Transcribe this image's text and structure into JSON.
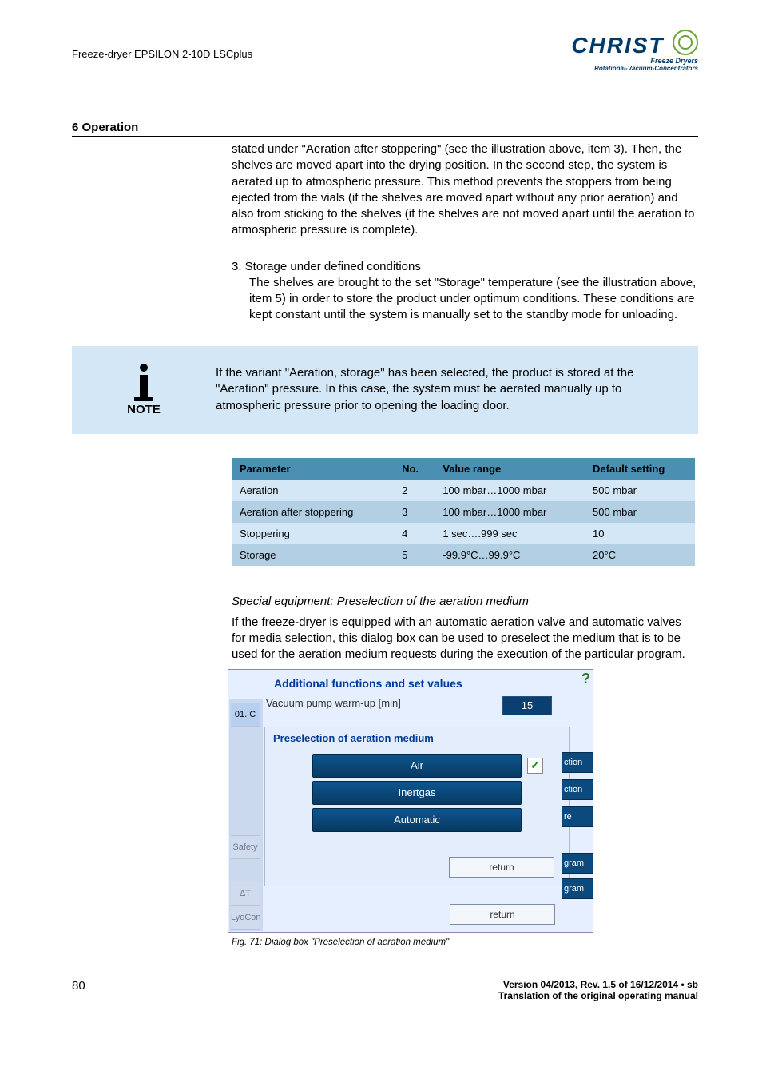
{
  "header": {
    "doc_title": "Freeze-dryer EPSILON 2-10D LSCplus",
    "logo_main": "CHRIST",
    "logo_sub1": "Freeze Dryers",
    "logo_sub2": "Rotational-Vacuum-Concentrators"
  },
  "section_title": "6 Operation",
  "para1": "stated under \"Aeration after stoppering\" (see the illustration above, item 3). Then, the shelves are moved apart into the drying position. In the second step, the system is aerated up to atmospheric pressure. This method prevents the stoppers from being ejected from the vials (if the shelves are moved apart without any prior aeration) and also from sticking to the shelves (if the shelves are not moved apart until the aeration to atmospheric pressure is complete).",
  "item3_title": "3.  Storage under defined conditions",
  "item3_body": "The shelves are brought to the set \"Storage\" temperature (see the illustration above, item 5) in order to store the product under optimum conditions. These conditions are kept constant until the system is manually set to the standby mode for unloading.",
  "note_label": "NOTE",
  "note_text": "If the variant \"Aeration, storage\" has been selected, the product is stored at the \"Aeration\" pressure. In this case, the system must be aerated manually up to atmospheric pressure prior to opening the loading door.",
  "table": {
    "headers": {
      "c1": "Parameter",
      "c2": "No.",
      "c3": "Value range",
      "c4": "Default setting"
    },
    "rows": [
      {
        "c1": "Aeration",
        "c2": "2",
        "c3": "100 mbar…1000 mbar",
        "c4": "500 mbar"
      },
      {
        "c1": "Aeration after stoppering",
        "c2": "3",
        "c3": "100 mbar…1000 mbar",
        "c4": "500 mbar"
      },
      {
        "c1": "Stoppering",
        "c2": "4",
        "c3": "1 sec….999 sec",
        "c4": "10"
      },
      {
        "c1": "Storage",
        "c2": "5",
        "c3": "-99.9°C…99.9°C",
        "c4": "20°C"
      }
    ]
  },
  "subheading": "Special equipment: Preselection of the aeration medium",
  "subbody": "If the freeze-dryer is equipped with an automatic aeration valve and automatic valves for media selection, this dialog box can be used to preselect the medium that is to be used for the aeration medium requests during the execution of the particular program.",
  "dialog": {
    "title": "Additional functions and set values",
    "help": "?",
    "tab_label": "01. C",
    "warmup_label": "Vacuum pump warm-up [min]",
    "warmup_value": "15",
    "inner_title": "Preselection of aeration medium",
    "btn_air": "Air",
    "btn_inert": "Inertgas",
    "btn_auto": "Automatic",
    "btn_return": "return",
    "btn_return_outer": "return",
    "check": "✓",
    "left_safety": "Safety",
    "left_dt": "ΔT",
    "left_lyo": "LyoCon",
    "right_ction1": "ction",
    "right_ction2": "ction",
    "right_re": "re",
    "right_gram1": "gram",
    "right_gram2": "gram"
  },
  "fig_caption": "Fig. 71: Dialog box \"Preselection of aeration medium\"",
  "footer": {
    "page": "80",
    "version": "Version 04/2013, Rev. 1.5 of 16/12/2014 • sb",
    "trans": "Translation of the original operating manual"
  }
}
